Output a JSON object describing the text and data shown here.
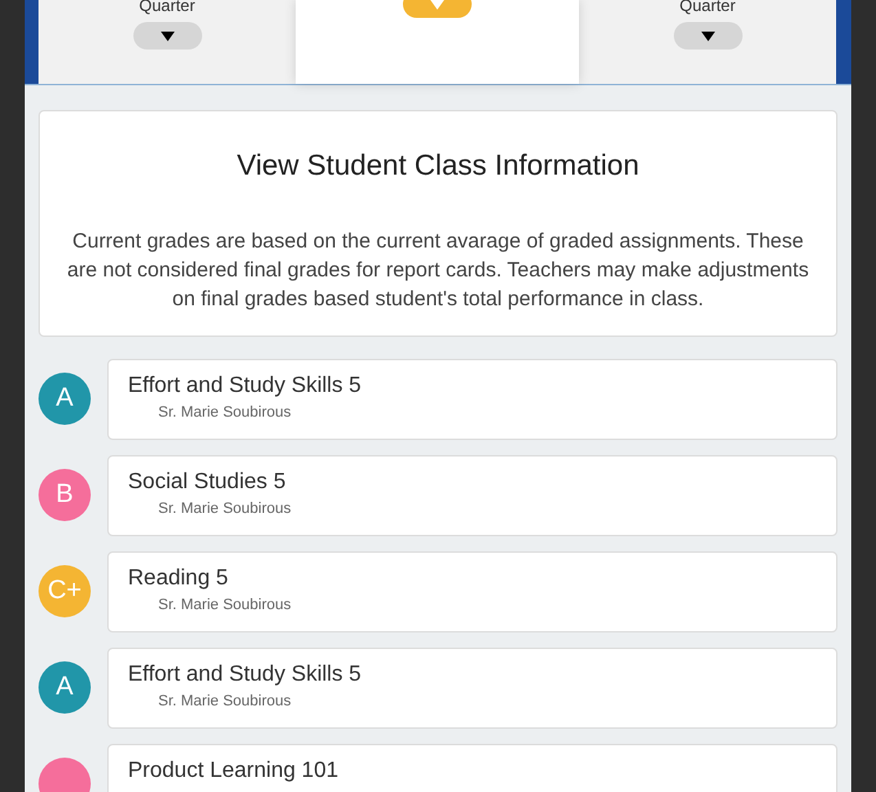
{
  "tabs": [
    {
      "label": "Quarter",
      "selected": false
    },
    {
      "selected": true
    },
    {
      "label": "Quarter",
      "selected": false
    }
  ],
  "info": {
    "title": "View Student Class Information",
    "text": "Current grades are based on the current avarage of graded assignments. These are not considered final grades for report cards. Teachers may make adjustments on final grades based student's total performance in class."
  },
  "classes": [
    {
      "grade": "A",
      "color": "#2196a9",
      "name": "Effort and Study Skills 5",
      "teacher": "Sr. Marie Soubirous"
    },
    {
      "grade": "B",
      "color": "#f56e9b",
      "name": "Social Studies 5",
      "teacher": "Sr. Marie Soubirous"
    },
    {
      "grade": "C+",
      "color": "#f4b533",
      "name": "Reading 5",
      "teacher": "Sr. Marie Soubirous"
    },
    {
      "grade": "A",
      "color": "#2196a9",
      "name": "Effort and Study Skills 5",
      "teacher": "Sr. Marie Soubirous"
    },
    {
      "color": "#f56e9b",
      "name": "Product Learning 101"
    }
  ]
}
